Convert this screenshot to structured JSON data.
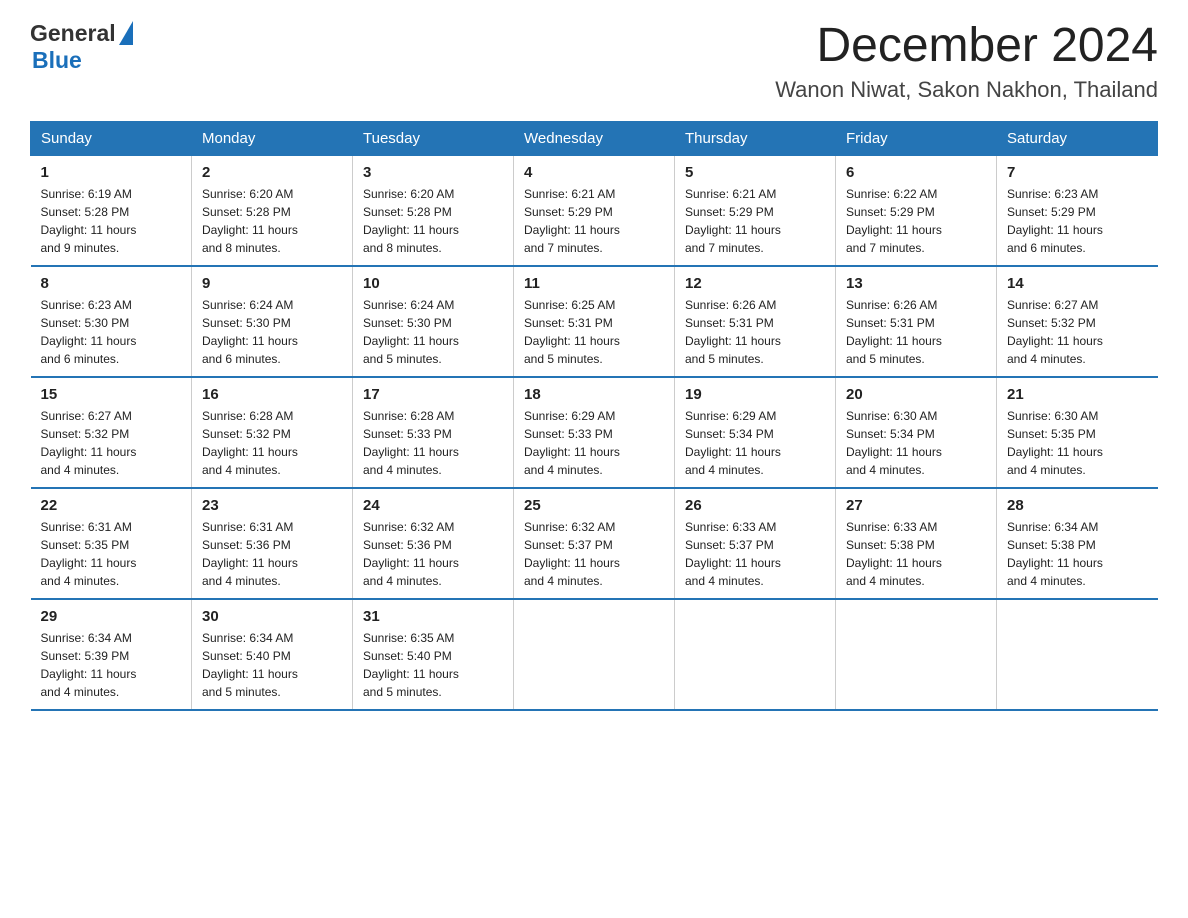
{
  "header": {
    "logo_general": "General",
    "logo_blue": "Blue",
    "title": "December 2024",
    "subtitle": "Wanon Niwat, Sakon Nakhon, Thailand"
  },
  "days_of_week": [
    "Sunday",
    "Monday",
    "Tuesday",
    "Wednesday",
    "Thursday",
    "Friday",
    "Saturday"
  ],
  "weeks": [
    [
      {
        "day": "1",
        "info": "Sunrise: 6:19 AM\nSunset: 5:28 PM\nDaylight: 11 hours\nand 9 minutes."
      },
      {
        "day": "2",
        "info": "Sunrise: 6:20 AM\nSunset: 5:28 PM\nDaylight: 11 hours\nand 8 minutes."
      },
      {
        "day": "3",
        "info": "Sunrise: 6:20 AM\nSunset: 5:28 PM\nDaylight: 11 hours\nand 8 minutes."
      },
      {
        "day": "4",
        "info": "Sunrise: 6:21 AM\nSunset: 5:29 PM\nDaylight: 11 hours\nand 7 minutes."
      },
      {
        "day": "5",
        "info": "Sunrise: 6:21 AM\nSunset: 5:29 PM\nDaylight: 11 hours\nand 7 minutes."
      },
      {
        "day": "6",
        "info": "Sunrise: 6:22 AM\nSunset: 5:29 PM\nDaylight: 11 hours\nand 7 minutes."
      },
      {
        "day": "7",
        "info": "Sunrise: 6:23 AM\nSunset: 5:29 PM\nDaylight: 11 hours\nand 6 minutes."
      }
    ],
    [
      {
        "day": "8",
        "info": "Sunrise: 6:23 AM\nSunset: 5:30 PM\nDaylight: 11 hours\nand 6 minutes."
      },
      {
        "day": "9",
        "info": "Sunrise: 6:24 AM\nSunset: 5:30 PM\nDaylight: 11 hours\nand 6 minutes."
      },
      {
        "day": "10",
        "info": "Sunrise: 6:24 AM\nSunset: 5:30 PM\nDaylight: 11 hours\nand 5 minutes."
      },
      {
        "day": "11",
        "info": "Sunrise: 6:25 AM\nSunset: 5:31 PM\nDaylight: 11 hours\nand 5 minutes."
      },
      {
        "day": "12",
        "info": "Sunrise: 6:26 AM\nSunset: 5:31 PM\nDaylight: 11 hours\nand 5 minutes."
      },
      {
        "day": "13",
        "info": "Sunrise: 6:26 AM\nSunset: 5:31 PM\nDaylight: 11 hours\nand 5 minutes."
      },
      {
        "day": "14",
        "info": "Sunrise: 6:27 AM\nSunset: 5:32 PM\nDaylight: 11 hours\nand 4 minutes."
      }
    ],
    [
      {
        "day": "15",
        "info": "Sunrise: 6:27 AM\nSunset: 5:32 PM\nDaylight: 11 hours\nand 4 minutes."
      },
      {
        "day": "16",
        "info": "Sunrise: 6:28 AM\nSunset: 5:32 PM\nDaylight: 11 hours\nand 4 minutes."
      },
      {
        "day": "17",
        "info": "Sunrise: 6:28 AM\nSunset: 5:33 PM\nDaylight: 11 hours\nand 4 minutes."
      },
      {
        "day": "18",
        "info": "Sunrise: 6:29 AM\nSunset: 5:33 PM\nDaylight: 11 hours\nand 4 minutes."
      },
      {
        "day": "19",
        "info": "Sunrise: 6:29 AM\nSunset: 5:34 PM\nDaylight: 11 hours\nand 4 minutes."
      },
      {
        "day": "20",
        "info": "Sunrise: 6:30 AM\nSunset: 5:34 PM\nDaylight: 11 hours\nand 4 minutes."
      },
      {
        "day": "21",
        "info": "Sunrise: 6:30 AM\nSunset: 5:35 PM\nDaylight: 11 hours\nand 4 minutes."
      }
    ],
    [
      {
        "day": "22",
        "info": "Sunrise: 6:31 AM\nSunset: 5:35 PM\nDaylight: 11 hours\nand 4 minutes."
      },
      {
        "day": "23",
        "info": "Sunrise: 6:31 AM\nSunset: 5:36 PM\nDaylight: 11 hours\nand 4 minutes."
      },
      {
        "day": "24",
        "info": "Sunrise: 6:32 AM\nSunset: 5:36 PM\nDaylight: 11 hours\nand 4 minutes."
      },
      {
        "day": "25",
        "info": "Sunrise: 6:32 AM\nSunset: 5:37 PM\nDaylight: 11 hours\nand 4 minutes."
      },
      {
        "day": "26",
        "info": "Sunrise: 6:33 AM\nSunset: 5:37 PM\nDaylight: 11 hours\nand 4 minutes."
      },
      {
        "day": "27",
        "info": "Sunrise: 6:33 AM\nSunset: 5:38 PM\nDaylight: 11 hours\nand 4 minutes."
      },
      {
        "day": "28",
        "info": "Sunrise: 6:34 AM\nSunset: 5:38 PM\nDaylight: 11 hours\nand 4 minutes."
      }
    ],
    [
      {
        "day": "29",
        "info": "Sunrise: 6:34 AM\nSunset: 5:39 PM\nDaylight: 11 hours\nand 4 minutes."
      },
      {
        "day": "30",
        "info": "Sunrise: 6:34 AM\nSunset: 5:40 PM\nDaylight: 11 hours\nand 5 minutes."
      },
      {
        "day": "31",
        "info": "Sunrise: 6:35 AM\nSunset: 5:40 PM\nDaylight: 11 hours\nand 5 minutes."
      },
      {
        "day": "",
        "info": ""
      },
      {
        "day": "",
        "info": ""
      },
      {
        "day": "",
        "info": ""
      },
      {
        "day": "",
        "info": ""
      }
    ]
  ]
}
